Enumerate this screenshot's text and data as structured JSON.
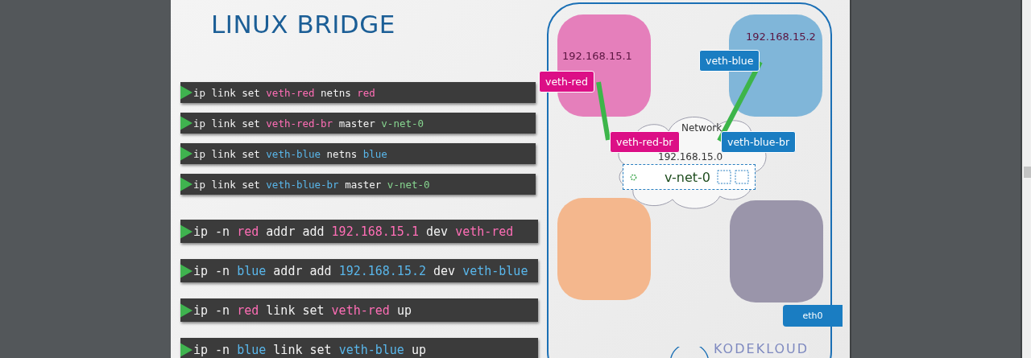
{
  "title": "LINUX BRIDGE",
  "command_groups": [
    {
      "kind": "compact",
      "commands": [
        {
          "tokens": [
            {
              "text": "ip link set",
              "color": "#f2f2f2"
            },
            {
              "text": "veth-red",
              "color": "#ff6eb6"
            },
            {
              "text": "netns",
              "color": "#f2f2f2"
            },
            {
              "text": "red",
              "color": "#ff6eb6"
            }
          ]
        },
        {
          "tokens": [
            {
              "text": "ip link set",
              "color": "#f2f2f2"
            },
            {
              "text": "veth-red-br",
              "color": "#ff6eb6"
            },
            {
              "text": "master",
              "color": "#f2f2f2"
            },
            {
              "text": "v-net-0",
              "color": "#86d48f"
            }
          ]
        },
        {
          "tokens": [
            {
              "text": "ip link set",
              "color": "#f2f2f2"
            },
            {
              "text": "veth-blue",
              "color": "#59b6ea"
            },
            {
              "text": "netns",
              "color": "#f2f2f2"
            },
            {
              "text": "blue",
              "color": "#59b6ea"
            }
          ]
        },
        {
          "tokens": [
            {
              "text": "ip link set",
              "color": "#f2f2f2"
            },
            {
              "text": "veth-blue-br",
              "color": "#59b6ea"
            },
            {
              "text": "master",
              "color": "#f2f2f2"
            },
            {
              "text": "v-net-0",
              "color": "#86d48f"
            }
          ]
        }
      ]
    },
    {
      "kind": "large",
      "commands": [
        {
          "tokens": [
            {
              "text": "ip -n",
              "color": "#f2f2f2"
            },
            {
              "text": "red",
              "color": "#ff6eb6"
            },
            {
              "text": "addr add",
              "color": "#f2f2f2"
            },
            {
              "text": "192.168.15.1",
              "color": "#ff6eb6"
            },
            {
              "text": "dev",
              "color": "#f2f2f2"
            },
            {
              "text": "veth-red",
              "color": "#ff6eb6"
            }
          ]
        },
        {
          "tokens": [
            {
              "text": "ip -n",
              "color": "#f2f2f2"
            },
            {
              "text": "blue",
              "color": "#59b6ea"
            },
            {
              "text": "addr add",
              "color": "#f2f2f2"
            },
            {
              "text": "192.168.15.2",
              "color": "#59b6ea"
            },
            {
              "text": "dev",
              "color": "#f2f2f2"
            },
            {
              "text": "veth-blue",
              "color": "#59b6ea"
            }
          ]
        },
        {
          "tokens": [
            {
              "text": "ip -n",
              "color": "#f2f2f2"
            },
            {
              "text": "red",
              "color": "#ff6eb6"
            },
            {
              "text": "link set",
              "color": "#f2f2f2"
            },
            {
              "text": "veth-red",
              "color": "#ff6eb6"
            },
            {
              "text": "up",
              "color": "#f2f2f2"
            }
          ]
        },
        {
          "tokens": [
            {
              "text": "ip -n",
              "color": "#f2f2f2"
            },
            {
              "text": "blue",
              "color": "#59b6ea"
            },
            {
              "text": "link set",
              "color": "#f2f2f2"
            },
            {
              "text": "veth-blue",
              "color": "#59b6ea"
            },
            {
              "text": "up",
              "color": "#f2f2f2"
            }
          ]
        }
      ]
    }
  ],
  "diagram": {
    "namespaces": [
      {
        "color": "#e57fbb",
        "address": "192.168.15.1"
      },
      {
        "color": "#80b6d9",
        "address": "192.168.15.2"
      },
      {
        "color": "#f4b78d"
      },
      {
        "color": "#9a95aa"
      }
    ],
    "interfaces": [
      {
        "label": "veth-red",
        "color": "#dc0f86"
      },
      {
        "label": "veth-blue",
        "color": "#1a7dc2"
      },
      {
        "label": "veth-red-br",
        "color": "#dc0f86"
      },
      {
        "label": "veth-blue-br",
        "color": "#1a7dc2"
      }
    ],
    "network": {
      "label": "Network",
      "subnet": "192.168.15.0",
      "bridge": "v-net-0"
    },
    "uplink": "eth0",
    "logo": "KODEKLOUD"
  }
}
